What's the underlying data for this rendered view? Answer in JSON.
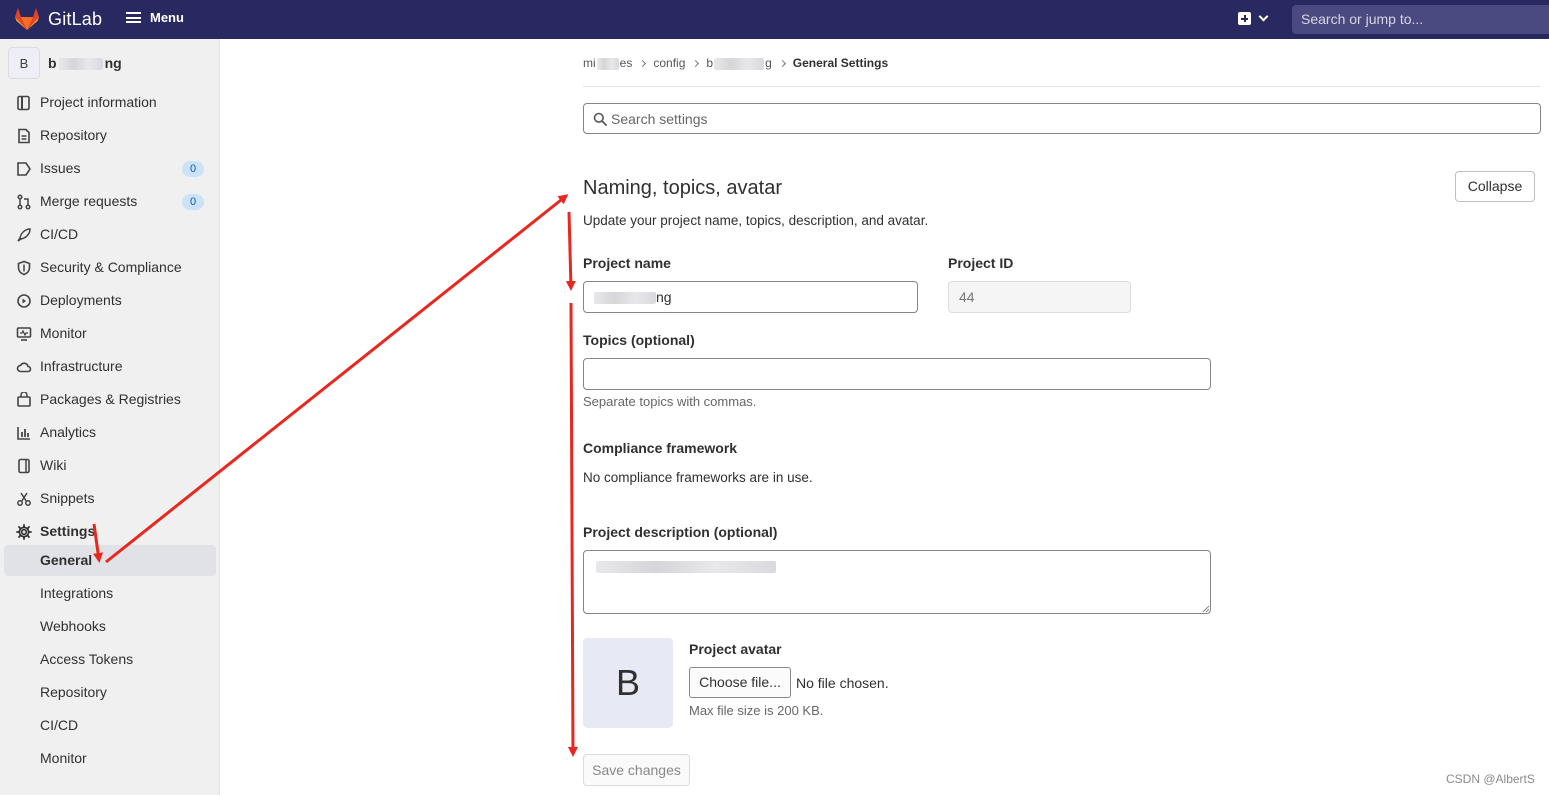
{
  "topbar": {
    "brand": "GitLab",
    "menu_label": "Menu",
    "search_placeholder": "Search or jump to..."
  },
  "sidebar": {
    "project_initial": "B",
    "project_name_start": "b",
    "project_name_end": "ng",
    "items": [
      {
        "label": "Project information",
        "icon": "book-icon"
      },
      {
        "label": "Repository",
        "icon": "document-icon"
      },
      {
        "label": "Issues",
        "icon": "issues-icon",
        "badge": "0"
      },
      {
        "label": "Merge requests",
        "icon": "merge-request-icon",
        "badge": "0"
      },
      {
        "label": "CI/CD",
        "icon": "rocket-icon"
      },
      {
        "label": "Security & Compliance",
        "icon": "shield-icon"
      },
      {
        "label": "Deployments",
        "icon": "deployments-icon"
      },
      {
        "label": "Monitor",
        "icon": "monitor-icon"
      },
      {
        "label": "Infrastructure",
        "icon": "cloud-icon"
      },
      {
        "label": "Packages & Registries",
        "icon": "package-icon"
      },
      {
        "label": "Analytics",
        "icon": "chart-icon"
      },
      {
        "label": "Wiki",
        "icon": "wiki-icon"
      },
      {
        "label": "Snippets",
        "icon": "scissors-icon"
      },
      {
        "label": "Settings",
        "icon": "gear-icon"
      }
    ],
    "settings_sub": [
      {
        "label": "General",
        "active": true
      },
      {
        "label": "Integrations"
      },
      {
        "label": "Webhooks"
      },
      {
        "label": "Access Tokens"
      },
      {
        "label": "Repository"
      },
      {
        "label": "CI/CD"
      },
      {
        "label": "Monitor"
      }
    ]
  },
  "breadcrumb": {
    "c1_start": "mi",
    "c1_end": "es",
    "c2": "config",
    "c3_start": "b",
    "c3_end": "g",
    "current": "General Settings"
  },
  "search_settings": {
    "placeholder": "Search settings"
  },
  "section": {
    "title": "Naming, topics, avatar",
    "description": "Update your project name, topics, description, and avatar.",
    "collapse_label": "Collapse"
  },
  "form": {
    "project_name_label": "Project name",
    "project_name_value_end": "ng",
    "project_id_label": "Project ID",
    "project_id_value": "44",
    "topics_label": "Topics (optional)",
    "topics_hint": "Separate topics with commas.",
    "compliance_label": "Compliance framework",
    "compliance_text": "No compliance frameworks are in use.",
    "description_label": "Project description (optional)",
    "avatar_initial": "B",
    "avatar_label": "Project avatar",
    "choose_file_label": "Choose file...",
    "no_file_text": "No file chosen.",
    "max_size_text": "Max file size is 200 KB.",
    "save_label": "Save changes"
  },
  "colors": {
    "navbar": "#292961",
    "arrow": "#e8281f",
    "badge_bg": "#cbe2f9",
    "badge_text": "#0b5cad"
  },
  "watermark": "CSDN @AlbertS"
}
